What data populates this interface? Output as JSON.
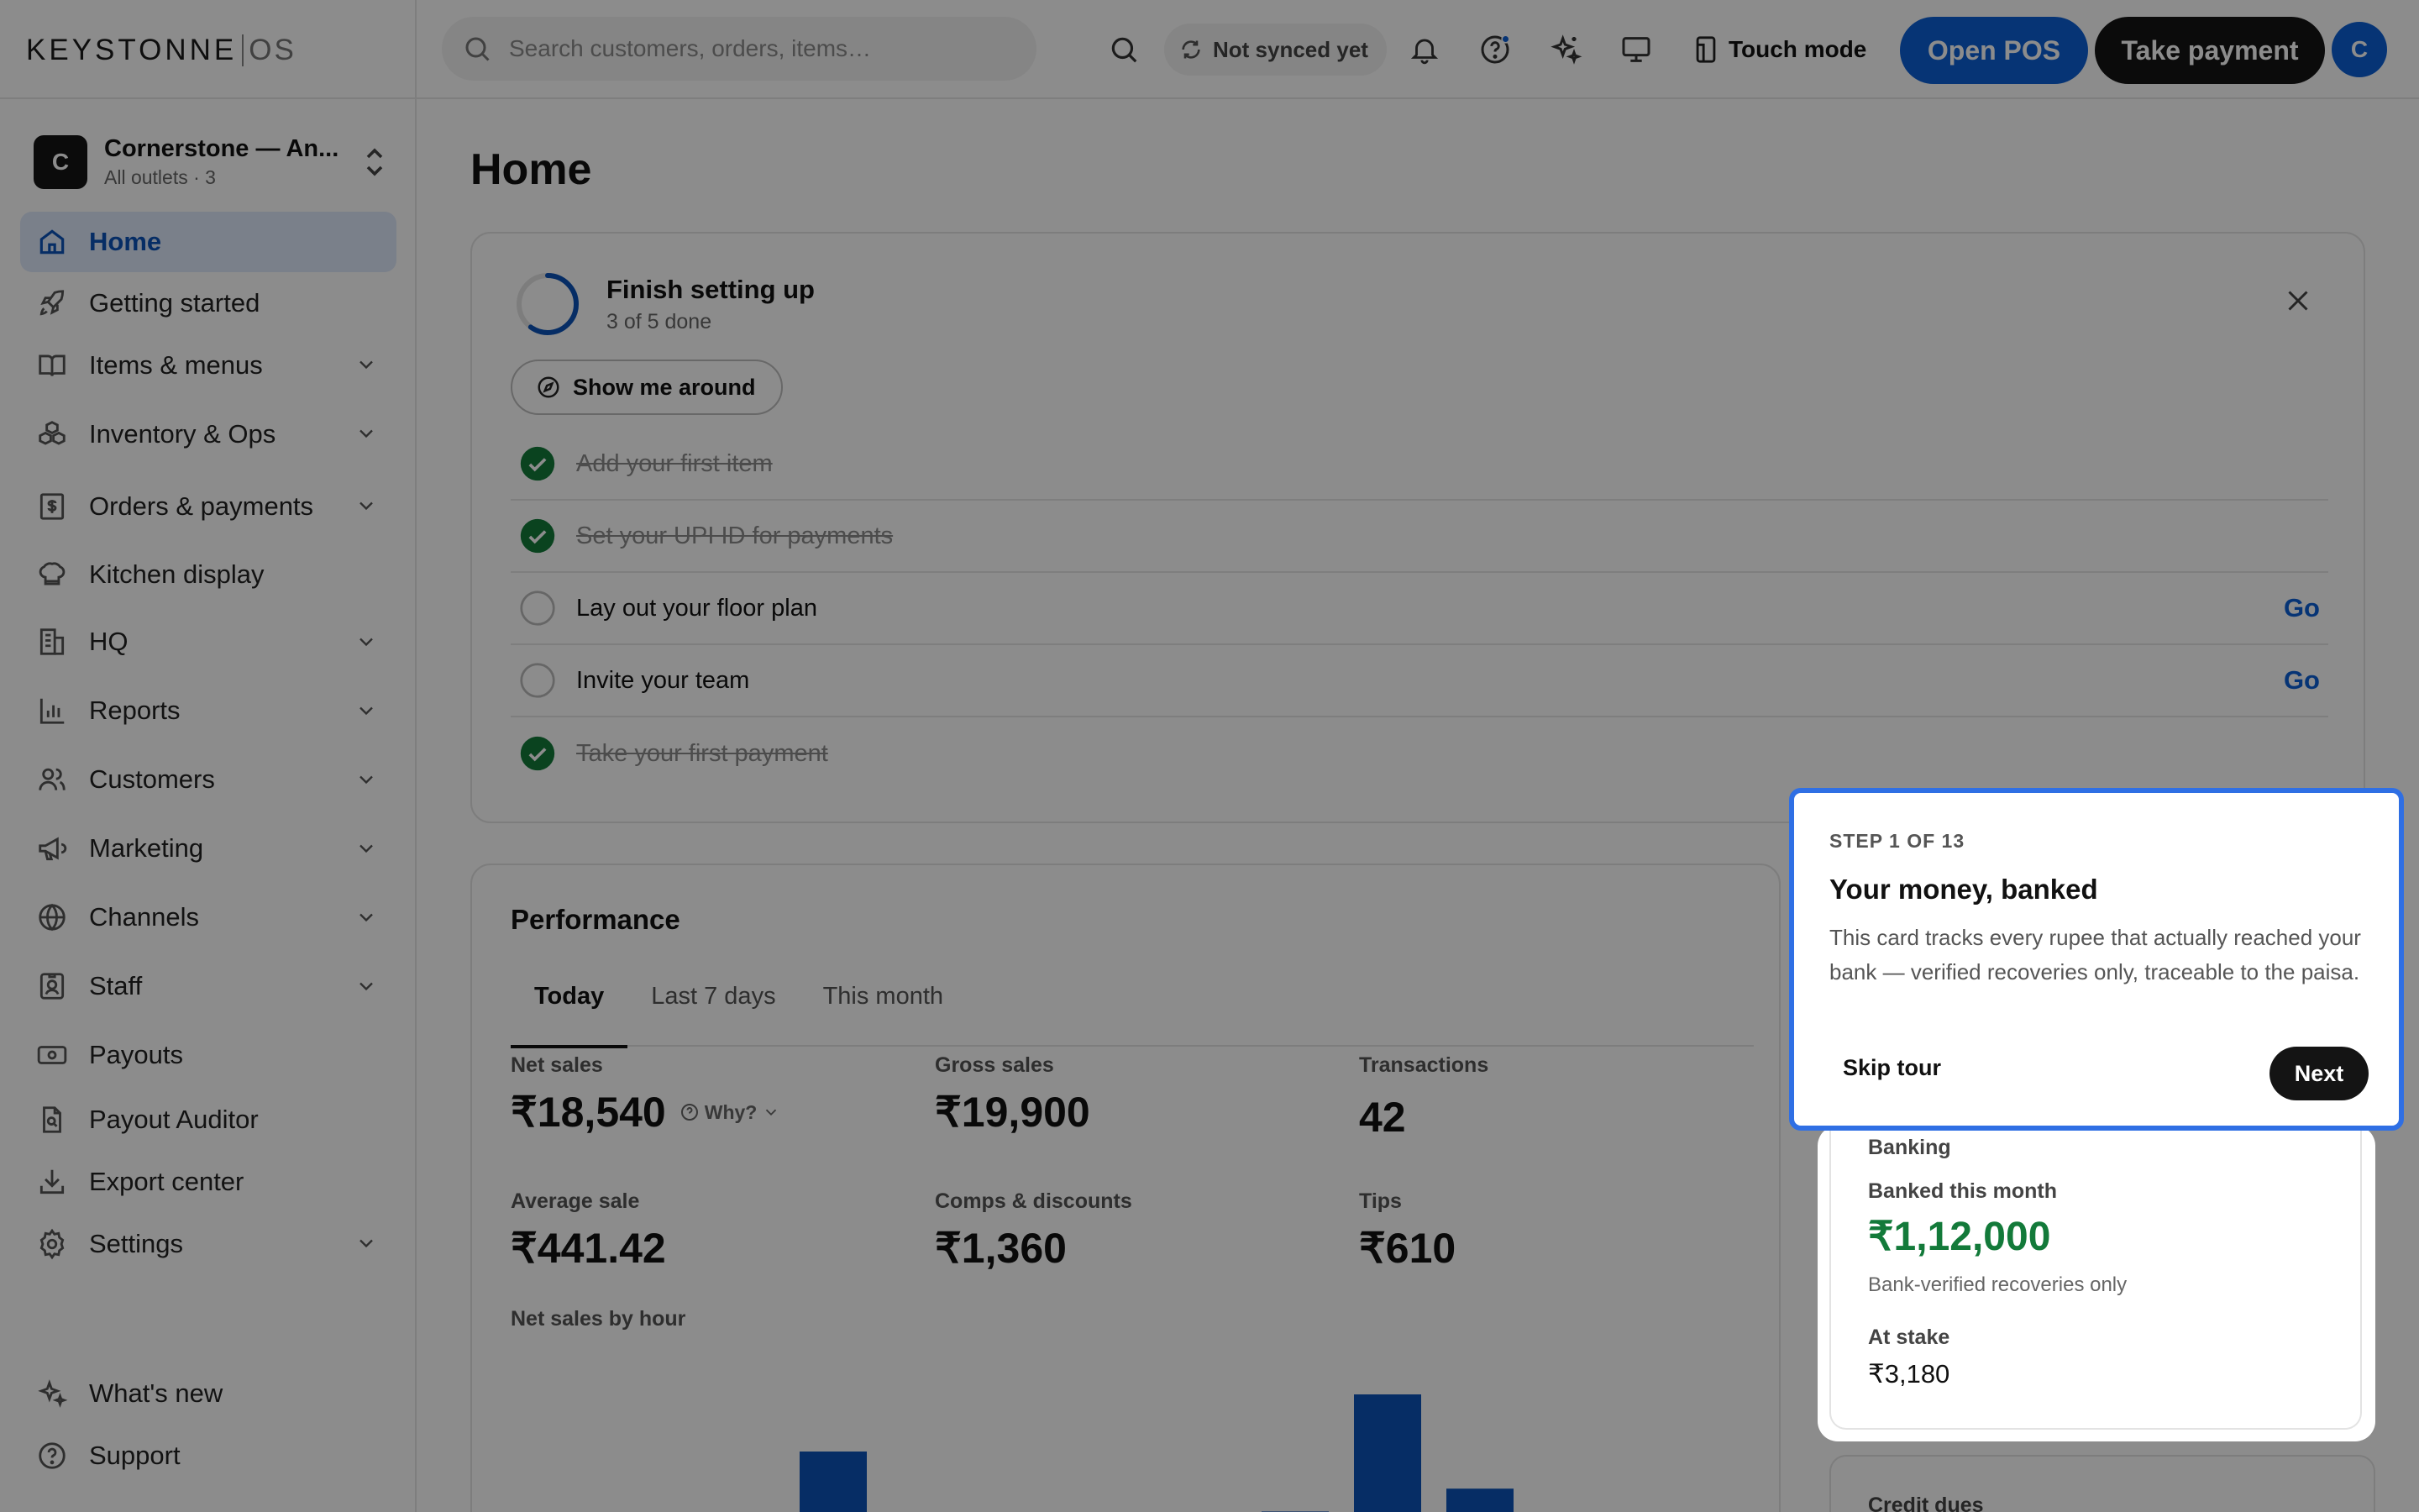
{
  "brand": {
    "name_part1": "KEYSTONNE",
    "name_part2": "OS"
  },
  "search": {
    "placeholder": "Search customers, orders, items…"
  },
  "topbar": {
    "sync_label": "Not synced yet",
    "touch_mode_label": "Touch mode",
    "open_pos_label": "Open POS",
    "take_payment_label": "Take payment",
    "avatar_initial": "C",
    "accent": "#0b5fd6"
  },
  "org": {
    "initial": "C",
    "name": "Cornerstone — An...",
    "sub": "All outlets · 3"
  },
  "sidebar": {
    "items": [
      {
        "label": "Home",
        "icon": "home-icon",
        "active": true
      },
      {
        "label": "Getting started",
        "icon": "rocket-icon"
      },
      {
        "label": "Items & menus",
        "icon": "book-icon",
        "expandable": true
      },
      {
        "label": "Inventory & Ops",
        "icon": "boxes-icon",
        "expandable": true
      },
      {
        "label": "Orders & payments",
        "icon": "receipt-icon",
        "expandable": true
      },
      {
        "label": "Kitchen display",
        "icon": "chef-hat-icon"
      },
      {
        "label": "HQ",
        "icon": "building-icon",
        "expandable": true
      },
      {
        "label": "Reports",
        "icon": "bar-chart-icon",
        "expandable": true
      },
      {
        "label": "Customers",
        "icon": "users-icon",
        "expandable": true
      },
      {
        "label": "Marketing",
        "icon": "megaphone-icon",
        "expandable": true
      },
      {
        "label": "Channels",
        "icon": "globe-icon",
        "expandable": true
      },
      {
        "label": "Staff",
        "icon": "id-badge-icon",
        "expandable": true
      },
      {
        "label": "Payouts",
        "icon": "banknote-icon"
      },
      {
        "label": "Payout Auditor",
        "icon": "file-search-icon"
      },
      {
        "label": "Export center",
        "icon": "download-icon"
      },
      {
        "label": "Settings",
        "icon": "gear-icon",
        "expandable": true
      }
    ],
    "bottom": [
      {
        "label": "What's new",
        "icon": "sparkles-icon"
      },
      {
        "label": "Support",
        "icon": "help-circle-icon"
      }
    ]
  },
  "page": {
    "title": "Home"
  },
  "setup": {
    "title": "Finish setting up",
    "progress_text": "3 of 5 done",
    "progress_fraction": 0.6,
    "tour_button": "Show me around",
    "tasks": [
      {
        "label": "Add your first item",
        "done": true
      },
      {
        "label": "Set your UPI ID for payments",
        "done": true
      },
      {
        "label": "Lay out your floor plan",
        "done": false,
        "action": "Go"
      },
      {
        "label": "Invite your team",
        "done": false,
        "action": "Go"
      },
      {
        "label": "Take your first payment",
        "done": true
      }
    ]
  },
  "performance": {
    "title": "Performance",
    "tabs": [
      "Today",
      "Last 7 days",
      "This month"
    ],
    "metrics": {
      "net_sales": {
        "label": "Net sales",
        "value": "₹18,540",
        "why": "Why?"
      },
      "gross_sales": {
        "label": "Gross sales",
        "value": "₹19,900"
      },
      "transactions": {
        "label": "Transactions",
        "value": "42"
      },
      "average_sale": {
        "label": "Average sale",
        "value": "₹441.42"
      },
      "comps": {
        "label": "Comps & discounts",
        "value": "₹1,360"
      },
      "tips": {
        "label": "Tips",
        "value": "₹610"
      }
    },
    "chart_title": "Net sales by hour"
  },
  "chart_data": {
    "type": "bar",
    "title": "Net sales by hour",
    "visible_bars_relative_height": [
      0,
      0,
      0.05,
      0.6,
      0,
      0,
      0,
      0,
      0.18,
      1.0,
      0.34,
      0
    ],
    "color": "#0b52b8"
  },
  "banking": {
    "section": "Banking",
    "banked_label": "Banked this month",
    "banked_value": "₹1,12,000",
    "banked_note": "Bank-verified recoveries only",
    "stake_label": "At stake",
    "stake_value": "₹3,180",
    "positive_color": "#137a3a"
  },
  "credit": {
    "label": "Credit dues"
  },
  "tour": {
    "step": "STEP 1 OF 13",
    "title": "Your money, banked",
    "body": "This card tracks every rupee that actually reached your bank — verified recoveries only, traceable to the paisa.",
    "skip": "Skip tour",
    "next": "Next"
  }
}
